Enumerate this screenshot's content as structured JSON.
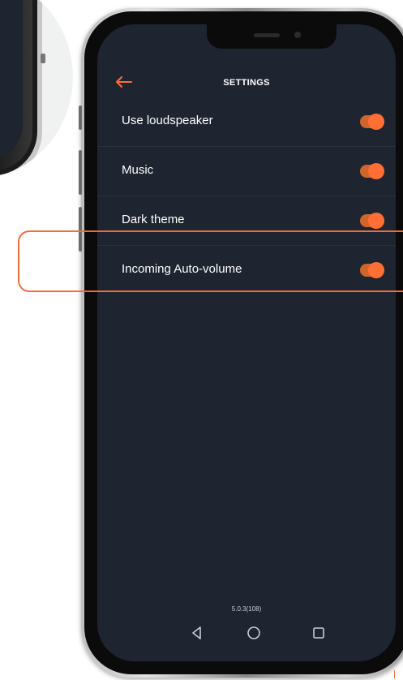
{
  "header": {
    "title": "SETTINGS",
    "back_icon": "arrow-left-icon"
  },
  "settings": [
    {
      "label": "Use loudspeaker",
      "enabled": true
    },
    {
      "label": "Music",
      "enabled": true
    },
    {
      "label": "Dark theme",
      "enabled": true
    },
    {
      "label": "Incoming Auto-volume",
      "enabled": true
    }
  ],
  "footer": {
    "version": "5.0.3(108)"
  },
  "nav": {
    "back_icon": "triangle-back-icon",
    "home_icon": "circle-home-icon",
    "recents_icon": "square-recents-icon"
  },
  "colors": {
    "screen_bg": "#1e2530",
    "accent": "#ff6f33",
    "highlight": "#f26c36"
  }
}
